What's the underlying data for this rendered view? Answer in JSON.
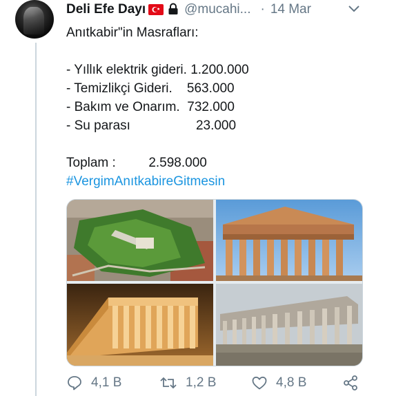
{
  "tweet": {
    "author_name": "Deli Efe Dayı",
    "handle": "@mucahi...",
    "separator": "·",
    "date": "14 Mar",
    "lines": [
      "Anıtkabir\"in Masrafları:",
      "",
      "- Yıllık elektrik gideri. 1.200.000",
      "- Temizlikçi Gideri.    563.000",
      "- Bakım ve Onarım.  732.000",
      "- Su parası                  23.000",
      "",
      "Toplam :         2.598.000"
    ],
    "hashtag": "#VergimAnıtkabireGitmesin"
  },
  "actions": {
    "reply_count": "4,1 B",
    "retweet_count": "1,2 B",
    "like_count": "4,8 B"
  },
  "colors": {
    "text": "#14171a",
    "muted": "#657786",
    "link": "#1b95e0",
    "flag": "#e30a17"
  },
  "icons": [
    "flag-icon",
    "lock-icon",
    "chevron-down-icon",
    "reply-icon",
    "retweet-icon",
    "like-icon",
    "share-icon"
  ]
}
